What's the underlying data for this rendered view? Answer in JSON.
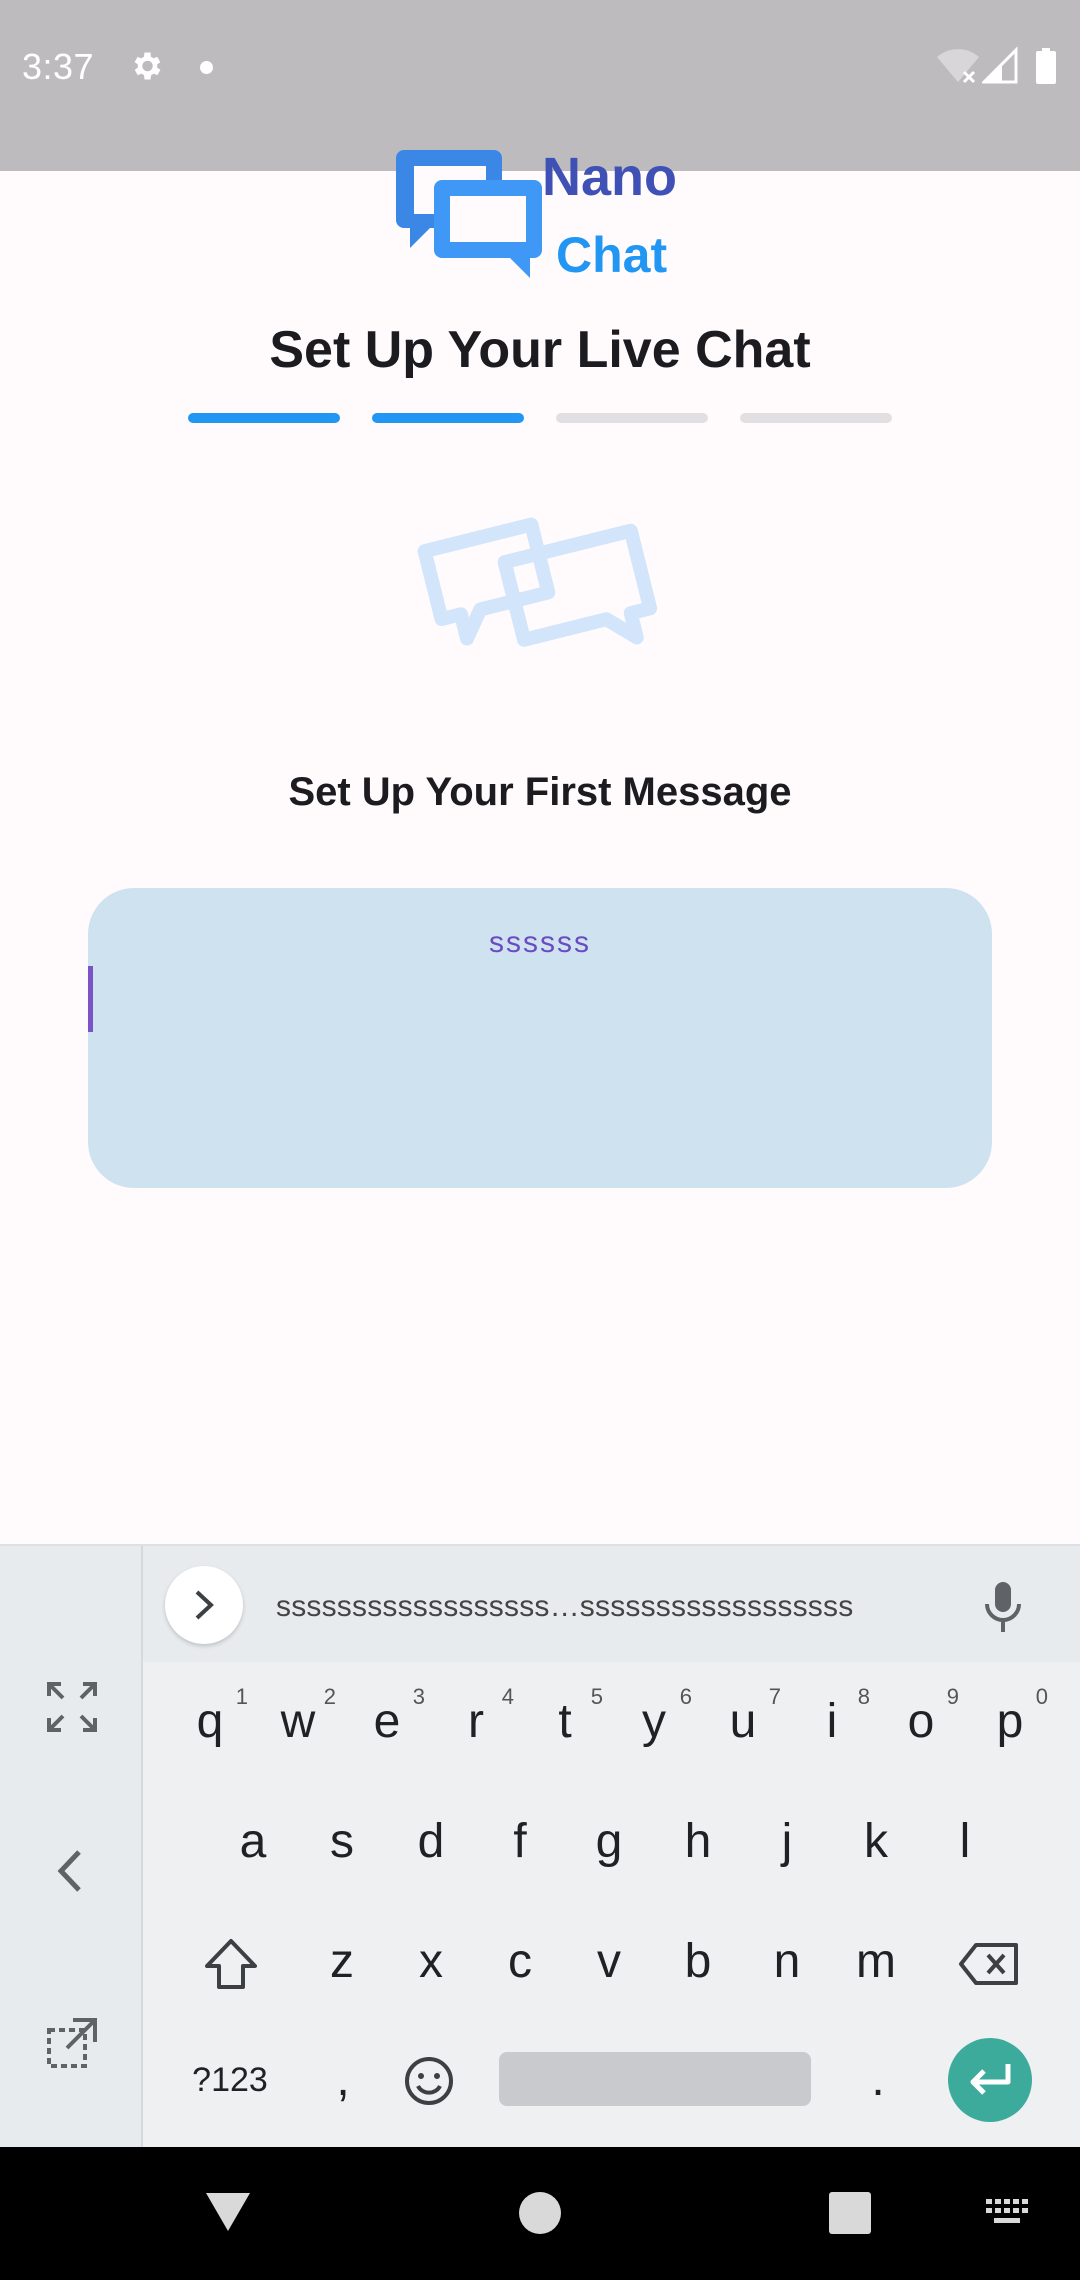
{
  "status_bar": {
    "time": "3:37"
  },
  "app": {
    "logo_nano": "Nano",
    "logo_chat": "Chat",
    "title": "Set Up Your Live Chat",
    "steps": {
      "total": 4,
      "completed": 2
    },
    "section_title": "Set Up Your First Message",
    "message_input": {
      "value": "ssssss"
    }
  },
  "keyboard": {
    "suggestion": "ssssssssssssssssss…ssssssssssssssssss",
    "row1": [
      "q",
      "w",
      "e",
      "r",
      "t",
      "y",
      "u",
      "i",
      "o",
      "p"
    ],
    "row1_hints": [
      "1",
      "2",
      "3",
      "4",
      "5",
      "6",
      "7",
      "8",
      "9",
      "0"
    ],
    "row2": [
      "a",
      "s",
      "d",
      "f",
      "g",
      "h",
      "j",
      "k",
      "l"
    ],
    "row3": [
      "z",
      "x",
      "c",
      "v",
      "b",
      "n",
      "m"
    ],
    "symbols_label": "?123",
    "comma": ",",
    "period": "."
  },
  "colors": {
    "primary_blue": "#2196f3",
    "indigo": "#3f51b5",
    "input_bg": "#cfe2f0",
    "enter_key": "#3dab9c"
  }
}
